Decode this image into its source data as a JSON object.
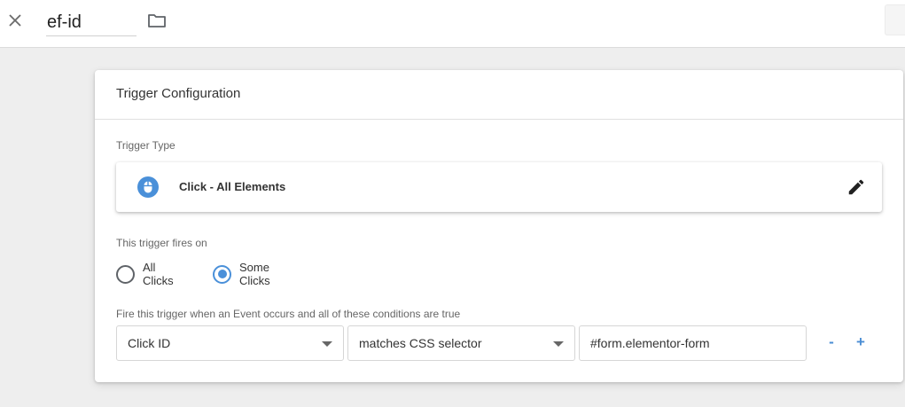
{
  "topbar": {
    "close_icon": "close-icon",
    "name_value": "ef-id",
    "folder_icon": "folder-icon"
  },
  "card": {
    "title": "Trigger Configuration",
    "trigger_type_label": "Trigger Type",
    "trigger_type": {
      "icon": "mouse-click-icon",
      "label": "Click - All Elements",
      "edit_icon": "pencil-icon"
    },
    "fires_on_label": "This trigger fires on",
    "fires_on_options": [
      {
        "label": "All Clicks",
        "selected": false
      },
      {
        "label": "Some Clicks",
        "selected": true
      }
    ],
    "conditions_label": "Fire this trigger when an Event occurs and all of these conditions are true",
    "condition": {
      "variable": "Click ID",
      "operator": "matches CSS selector",
      "value": "#form.elementor-form",
      "remove_label": "-",
      "add_label": "+"
    }
  },
  "colors": {
    "accent": "#4a90d9",
    "background": "#eeeeee"
  }
}
